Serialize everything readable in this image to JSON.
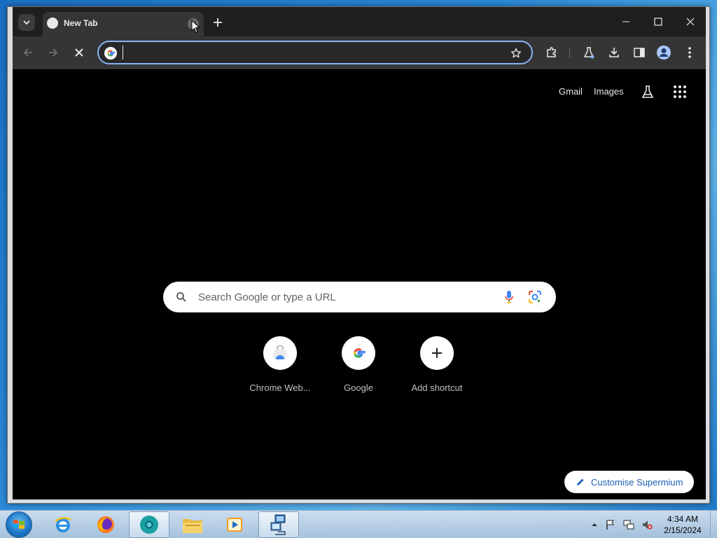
{
  "browser": {
    "tab": {
      "title": "New Tab"
    },
    "omnibox": {
      "value": "",
      "placeholder": ""
    }
  },
  "ntp": {
    "header_links": {
      "gmail": "Gmail",
      "images": "Images"
    },
    "search": {
      "placeholder": "Search Google or type a URL"
    },
    "shortcuts": [
      {
        "label": "Chrome Web...",
        "icon": "chrome-web-store-icon"
      },
      {
        "label": "Google",
        "icon": "google-icon"
      },
      {
        "label": "Add shortcut",
        "icon": "plus-icon"
      }
    ],
    "customise_label": "Customise Supermium"
  },
  "taskbar": {
    "apps": [
      "internet-explorer-icon",
      "firefox-icon",
      "chrome-icon",
      "file-explorer-icon",
      "media-player-icon",
      "network-app-icon"
    ],
    "clock": {
      "time": "4:34 AM",
      "date": "2/15/2024"
    }
  },
  "colors": {
    "accent": "#8ab4f8",
    "frame": "#1f1f1f",
    "toolbar": "#353535",
    "content_bg": "#000000"
  }
}
